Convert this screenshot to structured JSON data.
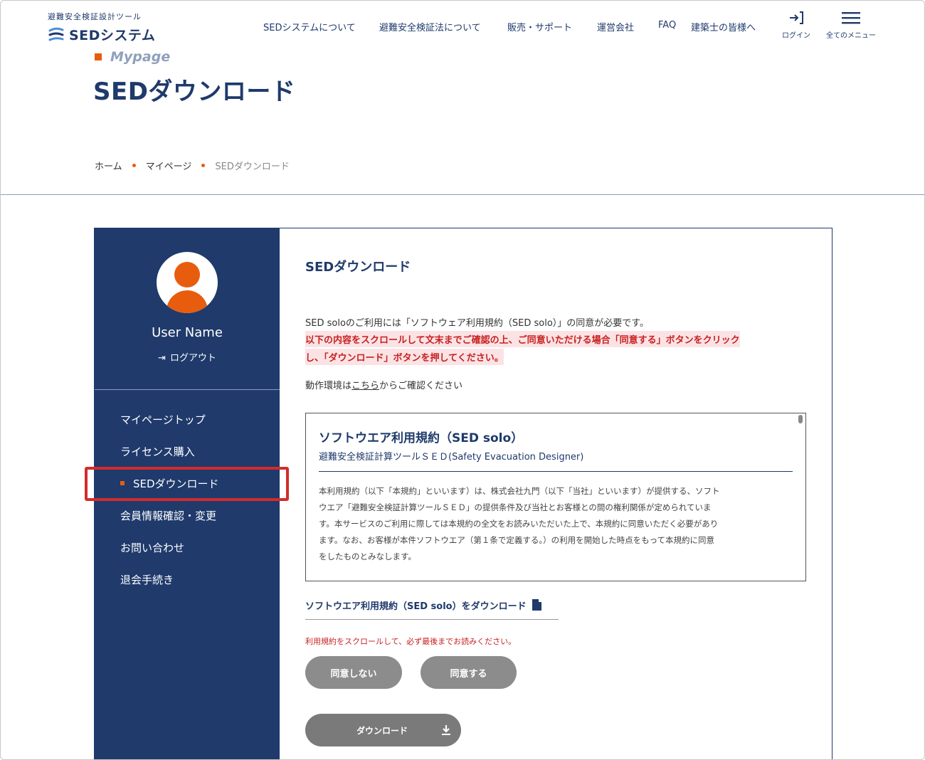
{
  "header": {
    "logo_subtitle": "避難安全検証設計ツール",
    "logo_title": "SEDシステム",
    "nav": [
      {
        "label": "SEDシステムについて"
      },
      {
        "label": "避難安全検証法について"
      },
      {
        "label": "販売・サポート"
      },
      {
        "label": "運営会社"
      },
      {
        "label": "FAQ"
      },
      {
        "label": "建築士の皆様へ"
      }
    ],
    "login_label": "ログイン",
    "menu_label": "全てのメニュー"
  },
  "page": {
    "section_label": "Mypage",
    "title": "SEDダウンロード"
  },
  "breadcrumb": {
    "home": "ホーム",
    "mypage": "マイページ",
    "current": "SEDダウンロード"
  },
  "sidebar": {
    "user_name": "User Name",
    "logout": "ログアウト",
    "menu": [
      {
        "label": "マイページトップ",
        "active": false
      },
      {
        "label": "ライセンス購入",
        "active": false
      },
      {
        "label": "SEDダウンロード",
        "active": true
      },
      {
        "label": "会員情報確認・変更",
        "active": false
      },
      {
        "label": "お問い合わせ",
        "active": false
      },
      {
        "label": "退会手続き",
        "active": false
      }
    ]
  },
  "content": {
    "title": "SEDダウンロード",
    "intro": "SED soloのご利用には「ソフトウェア利用規約（SED solo）」の同意が必要です。",
    "warning_line1": "以下の内容をスクロールして文末までご確認の上、ご同意いただける場合「同意する」ボタンをクリック",
    "warning_line2": "し、「ダウンロード」ボタンを押してください。",
    "env_prefix": "動作環境は",
    "env_link": "こちら",
    "env_suffix": "からご確認ください",
    "terms": {
      "title": "ソフトウエア利用規約（SED solo）",
      "subtitle": "避難安全検証計算ツールＳＥＤ(Safety Evacuation Designer)",
      "body_lines": [
        "本利用規約（以下「本規約」といいます）は、株式会社九門（以下「当社」といいます）が提供する、ソフト",
        "ウエア「避難安全検証計算ツールＳＥＤ」の提供条件及び当社とお客様との間の権利関係が定められていま",
        "す。本サービスのご利用に際しては本規約の全文をお読みいただいた上で、本規約に同意いただく必要があり",
        "ます。なお、お客様が本件ソフトウエア（第１条で定義する。）の利用を開始した時点をもって本規約に同意",
        "をしたものとみなします。"
      ]
    },
    "download_terms_link": "ソフトウエア利用規約（SED solo）をダウンロード",
    "scroll_note": "利用規約をスクロールして、必ず最後までお読みください。",
    "disagree_button": "同意しない",
    "agree_button": "同意する",
    "download_button": "ダウンロード"
  },
  "colors": {
    "navy": "#1f3a6b",
    "accent_orange": "#e85c0d",
    "warning_red": "#c81f1f",
    "warning_bg": "#fbe3e5",
    "button_gray": "#8c8c8c",
    "annotation_red": "#d42b2b"
  },
  "icons": {
    "login": "login-arrow-icon",
    "menu": "hamburger-icon",
    "logout": "logout-icon",
    "pdf": "pdf-file-icon",
    "download": "download-arrow-icon",
    "avatar": "user-avatar-icon"
  }
}
